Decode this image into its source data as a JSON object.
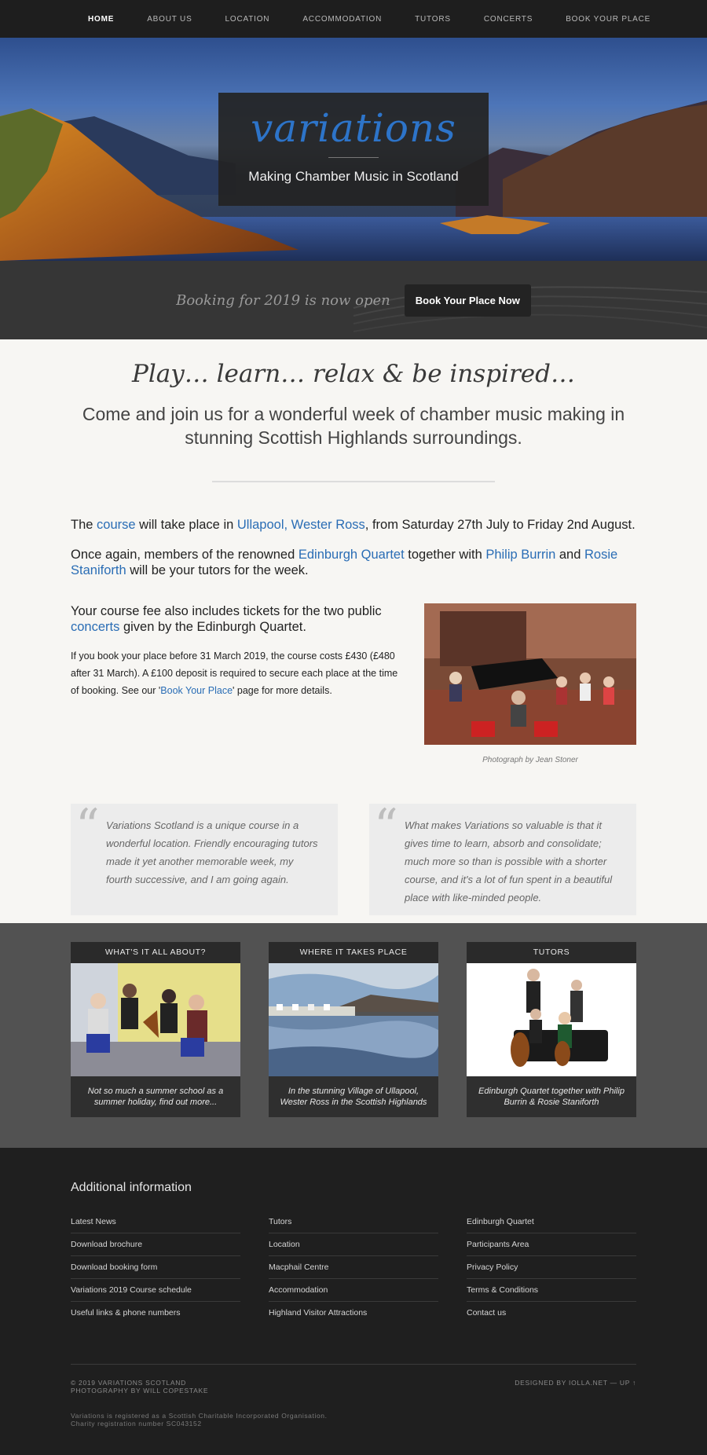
{
  "nav": {
    "items": [
      "HOME",
      "ABOUT US",
      "LOCATION",
      "ACCOMMODATION",
      "TUTORS",
      "CONCERTS",
      "BOOK YOUR PLACE"
    ]
  },
  "hero": {
    "logo": "variations",
    "tagline": "Making Chamber Music in Scotland"
  },
  "booking": {
    "text": "Booking for 2019 is now open",
    "button": "Book Your Place Now"
  },
  "main": {
    "headline": "Play… learn… relax & be inspired…",
    "intro": "Come and join us for a wonderful week of chamber music making in stunning Scottish Highlands surroundings.",
    "para1": {
      "t1": "The ",
      "link1": "course",
      "t2": " will take place in ",
      "link2": "Ullapool, Wester Ross",
      "t3": ", from Saturday 27th July to Friday 2nd August."
    },
    "para2": {
      "t1": "Once again, members of the renowned ",
      "link1": "Edinburgh Quartet",
      "t2": " together with ",
      "link2": "Philip Burrin",
      "t3": " and ",
      "link3": "Rosie Staniforth",
      "t4": " will be your tutors for the week."
    },
    "fee": {
      "t1": "Your course fee also includes tickets for the two public ",
      "link1": "concerts",
      "t2": " given by the Edinburgh Quartet.",
      "small1": "If you book your place before 31 March 2019, the course costs £430 (£480 after 31 March). A £100 deposit is required to secure each place at the time of booking. See our '",
      "small_link": "Book Your Place",
      "small2": "' page for more details."
    },
    "photo_caption": "Photograph by Jean Stoner",
    "quotes": [
      "Variations Scotland is a unique course in a wonderful location. Friendly encouraging tutors made it yet another memorable week, my fourth successive, and I am going again.",
      "What makes Variations so valuable is that it gives time to learn, absorb and consolidate; much more so than is possible with a shorter course, and it's a lot of fun spent in a beautiful place with like-minded people."
    ]
  },
  "cards": [
    {
      "title": "WHAT'S IT ALL ABOUT?",
      "caption": "Not so much a summer school as a summer holiday, find out more..."
    },
    {
      "title": "WHERE IT TAKES PLACE",
      "caption": "In the stunning Village of Ullapool, Wester Ross in the Scottish Highlands"
    },
    {
      "title": "TUTORS",
      "caption": "Edinburgh Quartet together with Philip Burrin & Rosie Staniforth"
    }
  ],
  "footer": {
    "title": "Additional information",
    "col1": [
      "Latest News",
      "Download brochure",
      "Download booking form",
      "Variations 2019 Course schedule",
      "Useful links & phone numbers"
    ],
    "col2": [
      "Tutors",
      "Location",
      "Macphail Centre",
      "Accommodation",
      "Highland Visitor Attractions"
    ],
    "col3": [
      "Edinburgh Quartet",
      "Participants Area",
      "Privacy Policy",
      "Terms & Conditions",
      "Contact us"
    ],
    "copyright": "© 2019 VARIATIONS SCOTLAND",
    "photography": "PHOTOGRAPHY BY WILL COPESTAKE",
    "designed": "DESIGNED BY IOLLA.NET — UP ↑",
    "legal1": "Variations is registered as a Scottish Charitable Incorporated Organisation.",
    "legal2": "Charity registration number SC043152"
  },
  "colors": {
    "link": "#2a6db5",
    "nav_bg": "#1e1e1e",
    "band_bg": "#525252",
    "footer_bg": "#1f1f1f"
  }
}
